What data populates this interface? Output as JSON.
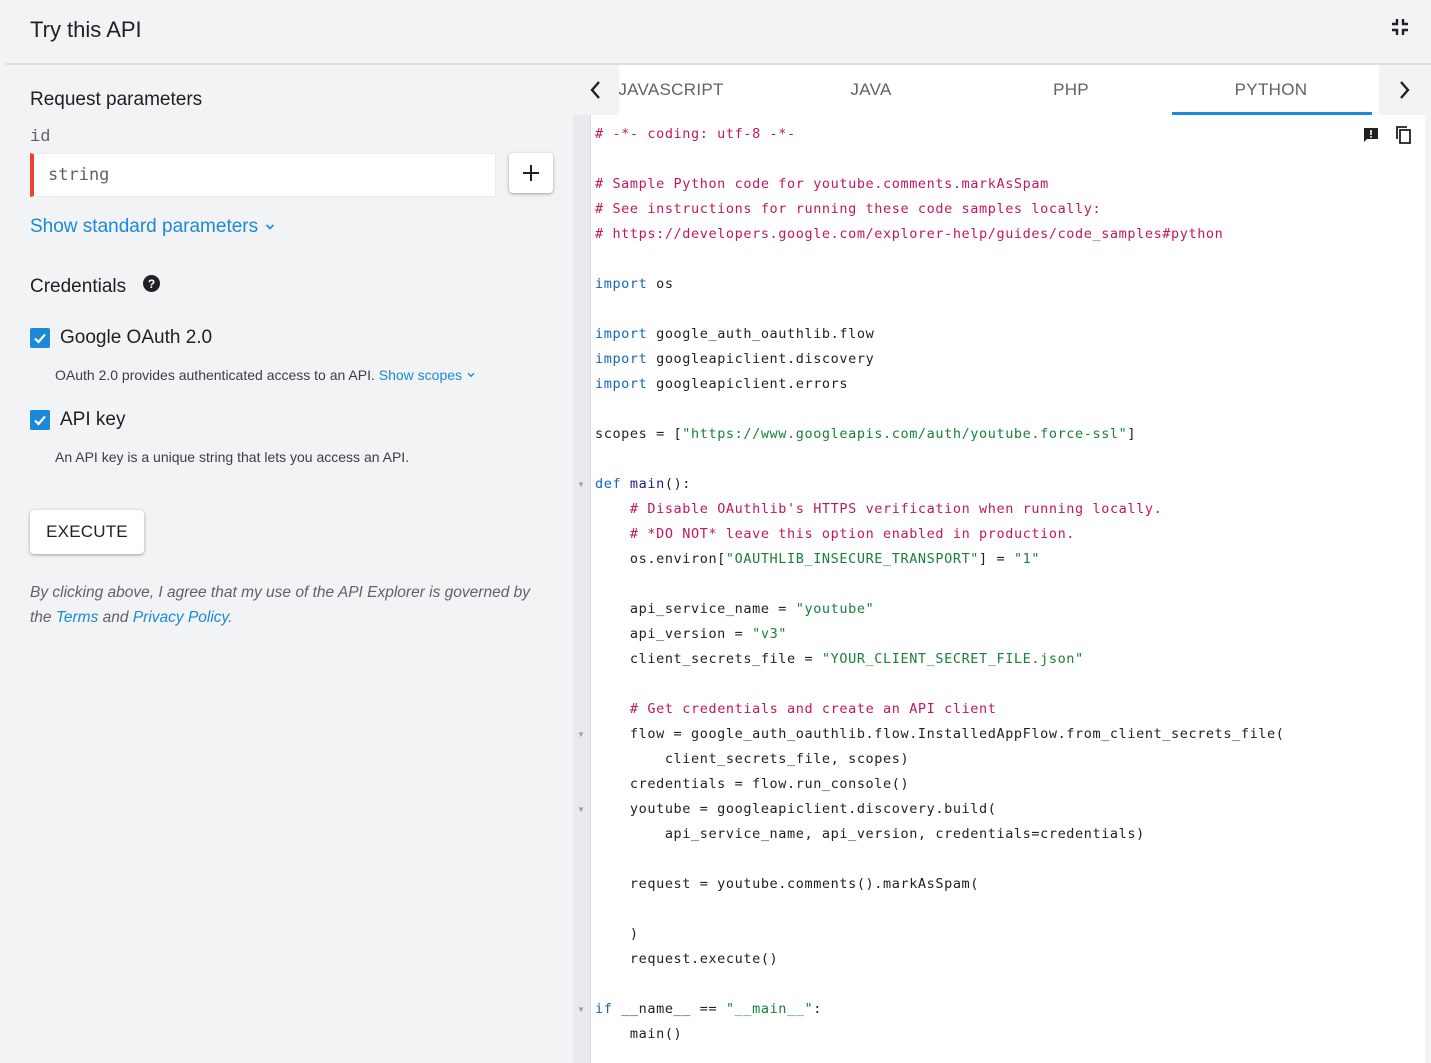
{
  "header": {
    "title": "Try this API",
    "collapse_icon": "collapse-fullscreen-icon"
  },
  "request": {
    "section_title": "Request parameters",
    "param_name": "id",
    "param_placeholder": "string",
    "add_label": "+",
    "show_standard": "Show standard parameters"
  },
  "credentials": {
    "section_title": "Credentials",
    "oauth": {
      "label": "Google OAuth 2.0",
      "checked": true,
      "description": "OAuth 2.0 provides authenticated access to an API.",
      "show_scopes": "Show scopes"
    },
    "apikey": {
      "label": "API key",
      "checked": true,
      "description": "An API key is a unique string that lets you access an API."
    }
  },
  "execute_label": "EXECUTE",
  "legal": {
    "text_before": "By clicking above, I agree that my use of the API Explorer is governed by the ",
    "terms": "Terms",
    "and": " and ",
    "privacy": "Privacy Policy",
    "end": "."
  },
  "tabs": [
    {
      "label": "JAVASCRIPT",
      "active": false
    },
    {
      "label": "JAVA",
      "active": false
    },
    {
      "label": "PHP",
      "active": false
    },
    {
      "label": "PYTHON",
      "active": true
    }
  ],
  "code_lines": [
    [
      [
        "c",
        "# -*- coding: utf-8 -*-"
      ]
    ],
    [],
    [
      [
        "c",
        "# Sample Python code for youtube.comments.markAsSpam"
      ]
    ],
    [
      [
        "c",
        "# See instructions for running these code samples locally:"
      ]
    ],
    [
      [
        "c",
        "# https://developers.google.com/explorer-help/guides/code_samples#python"
      ]
    ],
    [],
    [
      [
        "k",
        "import"
      ],
      [
        "p",
        " os"
      ]
    ],
    [],
    [
      [
        "k",
        "import"
      ],
      [
        "p",
        " google_auth_oauthlib.flow"
      ]
    ],
    [
      [
        "k",
        "import"
      ],
      [
        "p",
        " googleapiclient.discovery"
      ]
    ],
    [
      [
        "k",
        "import"
      ],
      [
        "p",
        " googleapiclient.errors"
      ]
    ],
    [],
    [
      [
        "p",
        "scopes = ["
      ],
      [
        "s",
        "\"https://www.googleapis.com/auth/youtube.force-ssl\""
      ],
      [
        "p",
        "]"
      ]
    ],
    [],
    [
      [
        "k",
        "def"
      ],
      [
        "p",
        " "
      ],
      [
        "f",
        "main"
      ],
      [
        "p",
        "():"
      ]
    ],
    [
      [
        "p",
        "    "
      ],
      [
        "c",
        "# Disable OAuthlib's HTTPS verification when running locally."
      ]
    ],
    [
      [
        "p",
        "    "
      ],
      [
        "c",
        "# *DO NOT* leave this option enabled in production."
      ]
    ],
    [
      [
        "p",
        "    os.environ["
      ],
      [
        "s",
        "\"OAUTHLIB_INSECURE_TRANSPORT\""
      ],
      [
        "p",
        "] = "
      ],
      [
        "s",
        "\"1\""
      ]
    ],
    [],
    [
      [
        "p",
        "    api_service_name = "
      ],
      [
        "s",
        "\"youtube\""
      ]
    ],
    [
      [
        "p",
        "    api_version = "
      ],
      [
        "s",
        "\"v3\""
      ]
    ],
    [
      [
        "p",
        "    client_secrets_file = "
      ],
      [
        "s",
        "\"YOUR_CLIENT_SECRET_FILE.json\""
      ]
    ],
    [],
    [
      [
        "p",
        "    "
      ],
      [
        "c",
        "# Get credentials and create an API client"
      ]
    ],
    [
      [
        "p",
        "    flow = google_auth_oauthlib.flow.InstalledAppFlow.from_client_secrets_file("
      ]
    ],
    [
      [
        "p",
        "        client_secrets_file, scopes)"
      ]
    ],
    [
      [
        "p",
        "    credentials = flow.run_console()"
      ]
    ],
    [
      [
        "p",
        "    youtube = googleapiclient.discovery.build("
      ]
    ],
    [
      [
        "p",
        "        api_service_name, api_version, credentials=credentials)"
      ]
    ],
    [],
    [
      [
        "p",
        "    request = youtube.comments().markAsSpam("
      ]
    ],
    [],
    [
      [
        "p",
        "    )"
      ]
    ],
    [
      [
        "p",
        "    request.execute()"
      ]
    ],
    [],
    [
      [
        "k",
        "if"
      ],
      [
        "p",
        " __name__ == "
      ],
      [
        "s",
        "\"__main__\""
      ],
      [
        "p",
        ":"
      ]
    ],
    [
      [
        "p",
        "    main()"
      ]
    ]
  ],
  "fold_lines": [
    14,
    24,
    27,
    35
  ]
}
